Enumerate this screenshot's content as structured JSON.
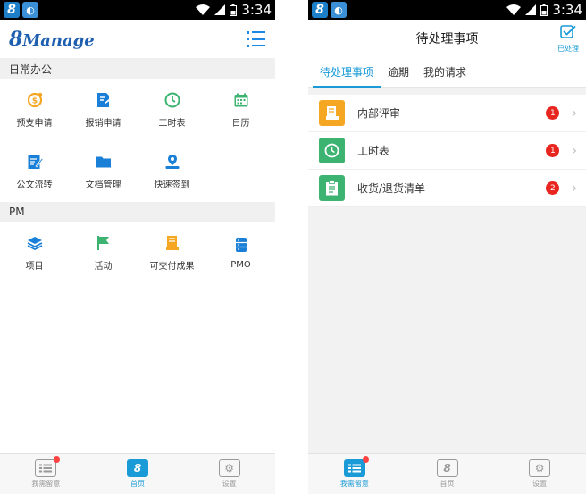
{
  "left": {
    "status": {
      "time": "3:34",
      "app_badge": "8"
    },
    "logo": {
      "num": "8",
      "text": "Manage"
    },
    "sections": [
      {
        "title": "日常办公",
        "items": [
          {
            "label": "预支申请",
            "icon": "advance-icon"
          },
          {
            "label": "报销申请",
            "icon": "reimburse-icon"
          },
          {
            "label": "工时表",
            "icon": "clock-icon"
          },
          {
            "label": "日历",
            "icon": "calendar-icon"
          },
          {
            "label": "公文流转",
            "icon": "document-edit-icon"
          },
          {
            "label": "文档管理",
            "icon": "folder-icon"
          },
          {
            "label": "快速签到",
            "icon": "location-checkin-icon"
          }
        ]
      },
      {
        "title": "PM",
        "items": [
          {
            "label": "项目",
            "icon": "layers-icon"
          },
          {
            "label": "活动",
            "icon": "flag-icon"
          },
          {
            "label": "可交付成果",
            "icon": "deliverable-icon"
          },
          {
            "label": "PMO",
            "icon": "database-icon"
          }
        ]
      }
    ],
    "tabs": [
      {
        "label": "我需留意",
        "icon": "attention-icon",
        "active": false,
        "dot": true
      },
      {
        "label": "首页",
        "icon": "home-8-icon",
        "active": true,
        "dot": false
      },
      {
        "label": "设置",
        "icon": "settings-icon",
        "active": false,
        "dot": false
      }
    ]
  },
  "right": {
    "status": {
      "time": "3:34",
      "app_badge": "8"
    },
    "title": "待处理事项",
    "done_label": "已处理",
    "subtabs": [
      "待处理事项",
      "逾期",
      "我的请求"
    ],
    "rows": [
      {
        "label": "内部评审",
        "count": "1",
        "icon": "review-icon",
        "color": "#f5a623"
      },
      {
        "label": "工时表",
        "count": "1",
        "icon": "clock-icon",
        "color": "#3cb371"
      },
      {
        "label": "收货/退货清单",
        "count": "2",
        "icon": "clipboard-icon",
        "color": "#3cb371"
      }
    ],
    "tabs": [
      {
        "label": "我需留意",
        "icon": "attention-icon",
        "active": true,
        "dot": true
      },
      {
        "label": "首页",
        "icon": "home-8-icon",
        "active": false,
        "dot": false
      },
      {
        "label": "设置",
        "icon": "settings-icon",
        "active": false,
        "dot": false
      }
    ]
  },
  "colors": {
    "accent": "#1a9bd7",
    "badge": "#e8251f",
    "statusbar": "#000000"
  }
}
